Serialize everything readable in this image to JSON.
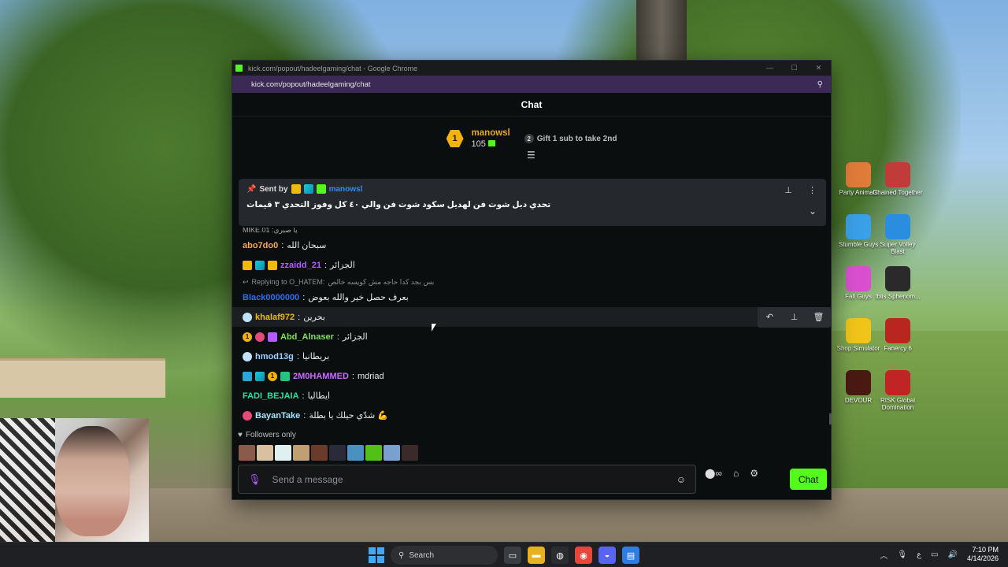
{
  "window": {
    "title": "kick.com/popout/hadeelgaming/chat - Google Chrome",
    "url": "kick.com/popout/hadeelgaming/chat"
  },
  "chat": {
    "header": "Chat",
    "leaderboard": {
      "rank": "1",
      "user": "manowsl",
      "count": "105",
      "next_rank": "2",
      "next_text": "Gift 1 sub to take 2nd"
    },
    "pinned": {
      "sent_by_label": "Sent by",
      "user": "manowsl",
      "message": "تحدي دبل شوت فن لهديل سكود شوت فن والي ٤٠ كل وفوز التحدي ٣ قيمات"
    },
    "clipped_top": "MIKE.01 :يا صبري",
    "messages": [
      {
        "user": "abo7do0",
        "color": "#f5a85a",
        "text": "سبحان الله",
        "badges": []
      },
      {
        "user": "zzaidd_21",
        "color": "#b35bff",
        "text": "الجزائر",
        "badges": [
          "crown",
          "og",
          "crown-small"
        ]
      },
      {
        "reply_to": "Replying to O_HATEM:",
        "reply_text": "بس بجد كدا حاجه مش كويسه خالص",
        "user": "Black0000000",
        "color": "#2f6fe8",
        "text": "بعرف حصل خير والله بعوض",
        "badges": []
      },
      {
        "user": "khalaf972",
        "color": "#f0b90b",
        "text": "بحرين",
        "badges": [
          "heart-w"
        ],
        "hover": true
      },
      {
        "user": "Abd_Alnaser",
        "color": "#7ee05a",
        "text": "الجزائر",
        "badges": [
          "sub",
          "heart",
          "purple"
        ]
      },
      {
        "user": "hmod13g",
        "color": "#9fd0ff",
        "text": "بريطانيا",
        "badges": [
          "heart-w"
        ]
      },
      {
        "user": "2M0HAMMED",
        "color": "#c86bff",
        "text": "mdriad",
        "badges": [
          "mod",
          "og",
          "sub",
          "vip"
        ]
      },
      {
        "user": "FADI_BEJAIA",
        "color": "#2ee0a0",
        "text": "ايطاليا",
        "badges": []
      },
      {
        "user": "BayanTake",
        "color": "#a8e6ff",
        "text": "شدّي حيلك يا بطلة 💪",
        "badges": [
          "heart"
        ]
      }
    ],
    "followers_label": "Followers only",
    "input": {
      "placeholder": "Send a message"
    },
    "send_label": "Chat"
  },
  "desktop_icons": [
    {
      "label": "Party Animals",
      "color": "#e07b39"
    },
    {
      "label": "Chained Together",
      "color": "#c23b3b"
    },
    {
      "label": "Stumble Guys",
      "color": "#3aa0e8"
    },
    {
      "label": "Super Volley Blast",
      "color": "#2b8de0"
    },
    {
      "label": "Fall Guys",
      "color": "#d94fd0"
    },
    {
      "label": "Iblis Sphenom...",
      "color": "#2a2a2a"
    },
    {
      "label": "Shop Simulator",
      "color": "#f0c419"
    },
    {
      "label": "Fanercy 6",
      "color": "#b8261f"
    },
    {
      "label": "DEVOUR",
      "color": "#4a1a12"
    },
    {
      "label": "RISK Global Domination",
      "color": "#c02525"
    }
  ],
  "taskbar": {
    "search": "Search",
    "time": "7:10 PM",
    "date": "4/14/2026",
    "lang": "ع"
  },
  "colors": {
    "accent": "#53fc18",
    "window_bg": "#0b0e0f",
    "address_bar": "#3a2a55"
  }
}
